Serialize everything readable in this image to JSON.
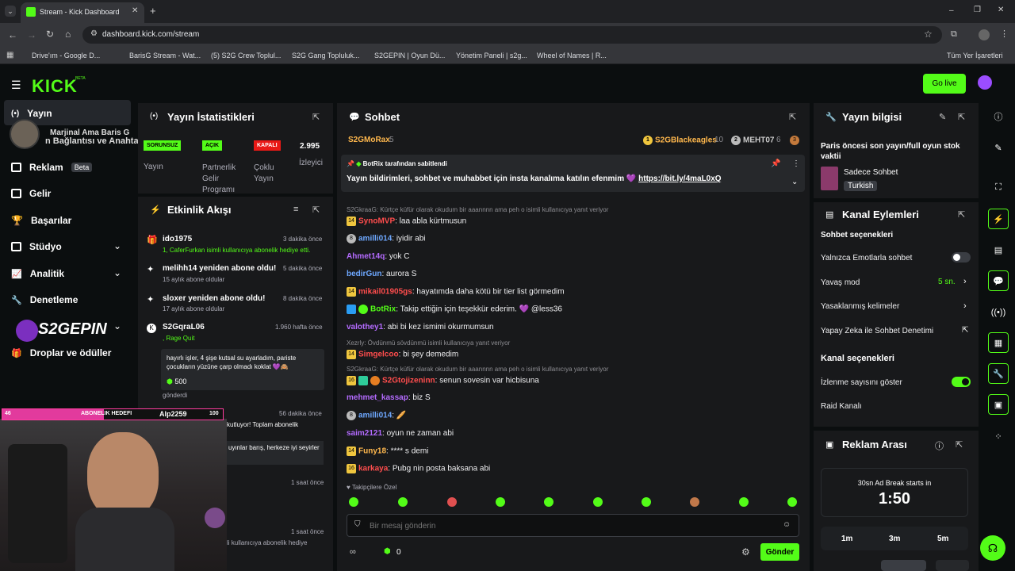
{
  "browser": {
    "tab_title": "Stream - Kick Dashboard",
    "url": "dashboard.kick.com/stream",
    "bookmarks": [
      "Drive'ım - Google D...",
      "BarisG Stream - Wat...",
      "(5) S2G Crew Toplul...",
      "S2G Gang Topluluk...",
      "S2GEPIN | Oyun Dü...",
      "Yönetim Paneli | s2g...",
      "Wheel of Names | R...",
      "Tüm Yer İşaretleri"
    ]
  },
  "header": {
    "logo": "KICK",
    "logo_beta": "BETA",
    "go_live": "Go live"
  },
  "sidebar": {
    "items": [
      {
        "label": "Yayın",
        "icon": "broadcast-icon"
      },
      {
        "label": "Reklam",
        "badge": "Beta",
        "icon": "monitor-icon"
      },
      {
        "label": "Gelir",
        "icon": "chart-icon"
      },
      {
        "label": "Başarılar",
        "icon": "trophy-icon"
      },
      {
        "label": "Stüdyo",
        "icon": "studio-icon"
      },
      {
        "label": "Analitik",
        "icon": "analytics-icon"
      },
      {
        "label": "Denetleme",
        "icon": "wrench-icon"
      },
      {
        "label": "Droplar ve ödüller",
        "icon": "gift-icon"
      }
    ],
    "overlay_text1": "Marjinal Ama Baris G",
    "overlay_text2": "n Bağlantısı ve Anahtarı",
    "overlay_logo": "S2GEPIN"
  },
  "stats": {
    "title": "Yayın İstatistikleri",
    "cols": [
      {
        "tag": "SORUNSUZ",
        "label": "Yayın"
      },
      {
        "tag": "AÇIK",
        "label": "Partnerlik Gelir Programı"
      },
      {
        "tag": "KAPALI",
        "label": "Çoklu Yayın"
      },
      {
        "tag": "2.995",
        "label": "İzleyici"
      }
    ]
  },
  "activity": {
    "title": "Etkinlik Akışı",
    "items": [
      {
        "name": "ido1975",
        "time": "3 dakika önce",
        "sub": "1, CaferFurkan isimli kullanıcıya abonelik hediye etti."
      },
      {
        "name": "melihh14 yeniden abone oldu!",
        "time": "5 dakika önce",
        "sub": "15 aylık abone oldular"
      },
      {
        "name": "sloxer yeniden abone oldu!",
        "time": "8 dakika önce",
        "sub": "17 aylık abone oldular"
      },
      {
        "name": "S2GqraL06",
        "time": "1.960 hafta önce",
        "sub": ", Rage Quit"
      }
    ],
    "quote": "hayırlı işler, 4 şişe kutsal su ayarladım, pariste çocukların yüzüne çarp olmadı koklat 💜🙈",
    "quote_amount": "500",
    "sent": "gönderdi",
    "time5": "56 dakika önce",
    "partial1": "kutluyor! Toplam abonelik",
    "partial2": "uyınlar barış, herkeze iyi seyirler",
    "time6": "1 saat önce",
    "time7": "1 saat önce",
    "partial3": "li kullanıcıya abonelik hediye"
  },
  "goal": {
    "left": "46",
    "label": "ABONELIK HEDEFI",
    "user": "Alp2259",
    "right": "100",
    "progress": 0.46
  },
  "chat": {
    "title": "Sohbet",
    "top_left": "S2GMoRax",
    "top_left_count": "5",
    "top_mid": "S2GBlackeagles",
    "top_mid_count": "10",
    "top_right": "MEHT07",
    "top_right_count": "6",
    "pinned_by": "BotRix tarafından sabitlendi",
    "pinned_text": "Yayın bildirimleri, sohbet ve muhabbet için insta kanalıma katılın efenmim 💜",
    "pinned_link": "https://bit.ly/4maL0xQ",
    "lines": [
      {
        "user": "S2GkraaG",
        "reply": "S2GkraaG: Kürtçe küfür olarak okudum bir aaannnn ama peh o isimli kullanıcıya yanıt veriyor",
        "text": ""
      },
      {
        "user": "SynoMVP",
        "text": ": laa abla kürtmusun",
        "color": "#ff4d4d",
        "badge": "14"
      },
      {
        "user": "amilli014",
        "text": ": iyidir abi",
        "color": "#6ea8ff",
        "badge": "8"
      },
      {
        "user": "Ahmet14q",
        "text": ": yok C",
        "color": "#b46bff"
      },
      {
        "user": "bedirGun",
        "text": ": aurora S",
        "color": "#6ea8ff"
      },
      {
        "user": "mikail01905gs",
        "text": ": hayatımda daha kötü bir tier list görmedim",
        "color": "#ff4d4d",
        "badge": "14"
      },
      {
        "user": "BotRix",
        "text": ": Takip ettiğin için teşekkür ederim. 💜 @less36",
        "color": "#53fc18"
      },
      {
        "user": "valothey1",
        "text": ": abi bi kez ismimi okurmumsun",
        "color": "#b46bff"
      },
      {
        "user": "Simgelcoo",
        "reply": "Xezrly: Övdünmü sövdünmü isimli kullanıcıya yanıt veriyor",
        "text": ": bi şey demedim",
        "color": "#ff4d4d",
        "badge": "14"
      },
      {
        "user": "S2Gtojizeninn",
        "reply": "S2GkraaG: Kürtçe küfür olarak okudum bir aaannnn ama peh o isimli kullanıcıya yanıt veriyor",
        "text": ": senun sovesin var hicbisuna",
        "color": "#ff4d4d",
        "badge": "16"
      },
      {
        "user": "mehmet_kassap",
        "text": ": biz S",
        "color": "#b46bff"
      },
      {
        "user": "amilli014",
        "text": ": 🥖",
        "color": "#6ea8ff",
        "badge": "8"
      },
      {
        "user": "saim2121",
        "text": ": oyun ne zaman abi",
        "color": "#b46bff"
      },
      {
        "user": "Funy18",
        "text": ": **** s demi",
        "color": "#ffb84d",
        "badge": "14"
      },
      {
        "user": "karkaya",
        "text": ": Pubg nin posta baksana abi",
        "color": "#ff4d4d",
        "badge": "16"
      }
    ],
    "followers_only": "Takipçilere Özel",
    "input_placeholder": "Bir mesaj gönderin",
    "points": "0",
    "send": "Gönder"
  },
  "stream_info": {
    "title": "Yayın bilgisi",
    "stream_title": "Paris öncesi son yayın/full oyun stok vaktii",
    "category": "Sadece Sohbet",
    "language": "Turkish"
  },
  "channel_actions": {
    "title": "Kanal Eylemleri",
    "chat_section": "Sohbet seçenekleri",
    "emotes_only": "Yalnızca Emotlarla sohbet",
    "slow_mode": "Yavaş mod",
    "slow_value": "5 sn.",
    "banned_words": "Yasaklanmış kelimeler",
    "ai_moderation": "Yapay Zeka ile Sohbet Denetimi",
    "channel_section": "Kanal seçenekleri",
    "show_viewers": "İzlenme sayısını göster",
    "raid": "Raid Kanalı"
  },
  "ad_break": {
    "title": "Reklam Arası",
    "caption": "30sn Ad Break starts in",
    "countdown": "1:50",
    "options": [
      "1m",
      "3m",
      "5m"
    ]
  },
  "colors": {
    "accent": "#53fc18",
    "panel": "#18191b",
    "bg": "#0b0e0f"
  }
}
